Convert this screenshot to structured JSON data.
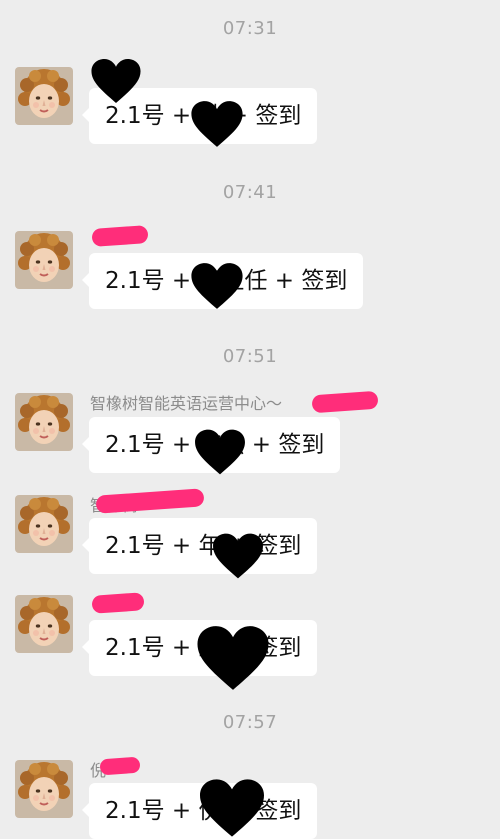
{
  "chat": {
    "groups": [
      {
        "time": "07:31"
      },
      {
        "time": "07:41"
      },
      {
        "time": "07:51"
      },
      {
        "time": "07:57"
      }
    ],
    "messages": [
      {
        "sender": "",
        "text": "2.1号 + 姚 + 签到"
      },
      {
        "sender": "",
        "text": "2.1号 + 班主任 + 签到"
      },
      {
        "sender": "智橡树智能英语运营中心～",
        "text": "2.1号 + 李杰 + 签到"
      },
      {
        "sender": "智橡树",
        "text": "2.1号 + 年 + 签到"
      },
      {
        "sender": "",
        "text": "2.1号 + 王 + 签到"
      },
      {
        "sender": "倪",
        "text": "2.1号 + 倪 + 签到"
      }
    ]
  },
  "colors": {
    "background": "#ededed",
    "bubble": "#ffffff",
    "redaction_pink": "#ff2d7a",
    "heart": "#000000"
  },
  "icons": [
    "avatar-portrait-icon",
    "heart-redaction-icon"
  ]
}
